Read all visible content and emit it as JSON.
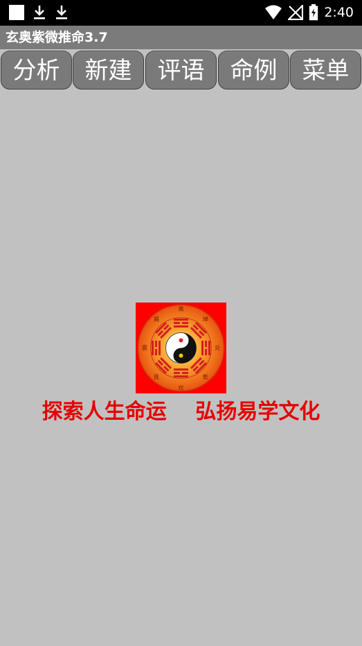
{
  "status_bar": {
    "time": "2:40",
    "icons": [
      "square-notification-icon",
      "download-icon",
      "download-icon",
      "wifi-icon",
      "no-signal-icon",
      "battery-charging-icon"
    ]
  },
  "app": {
    "title": "玄奥紫微推命3.7"
  },
  "tabs": [
    {
      "label": "分析"
    },
    {
      "label": "新建"
    },
    {
      "label": "评语"
    },
    {
      "label": "命例"
    },
    {
      "label": "菜单"
    }
  ],
  "content": {
    "logo": {
      "icon": "bagua-yin-yang-logo",
      "characters": [
        "离",
        "坤",
        "兑",
        "乾",
        "坎",
        "艮",
        "震",
        "巽"
      ]
    },
    "slogan": "探索人生命运    弘扬易学文化"
  },
  "colors": {
    "background": "#c1c1c1",
    "title_bar": "#7b7b7b",
    "tab_bg": "#7a7a7a",
    "slogan": "#e60000",
    "logo_red": "#ff0000",
    "logo_orange": "#f57e16"
  }
}
